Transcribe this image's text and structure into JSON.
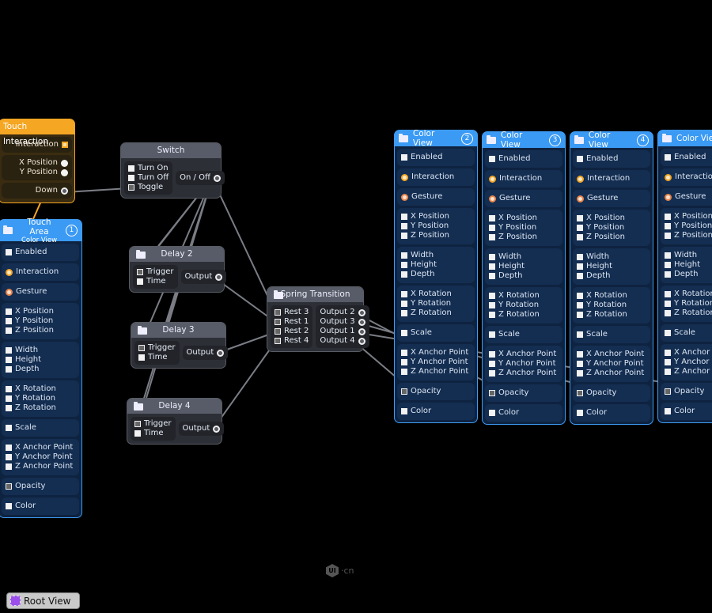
{
  "colors": {
    "layer_accent": "#3b9af4",
    "touch_accent": "#f5a623",
    "patch_header": "#585c68",
    "wire": "#7a7d85",
    "root_icon": "#9b4fe8"
  },
  "touch_interaction": {
    "title": "Touch Interaction",
    "ports": [
      "Interaction",
      "X Position",
      "Y Position",
      "Down"
    ]
  },
  "switch": {
    "title": "Switch",
    "inputs": [
      "Turn On",
      "Turn Off",
      "Toggle"
    ],
    "output": "On / Off"
  },
  "delays": [
    {
      "title": "Delay 2",
      "inputs": [
        "Trigger",
        "Time"
      ],
      "output": "Output"
    },
    {
      "title": "Delay 3",
      "inputs": [
        "Trigger",
        "Time"
      ],
      "output": "Output"
    },
    {
      "title": "Delay 4",
      "inputs": [
        "Trigger",
        "Time"
      ],
      "output": "Output"
    }
  ],
  "spring": {
    "title": "Spring Transition",
    "inputs": [
      "Rest 3",
      "Rest 1",
      "Rest 2",
      "Rest 4"
    ],
    "outputs": [
      "Output 2",
      "Output 3",
      "Output 1",
      "Output 4"
    ]
  },
  "layer_groups": [
    [
      "Enabled"
    ],
    [
      "Interaction"
    ],
    [
      "Gesture"
    ],
    [
      "X Position",
      "Y Position",
      "Z Position"
    ],
    [
      "Width",
      "Height",
      "Depth"
    ],
    [
      "X Rotation",
      "Y Rotation",
      "Z Rotation"
    ],
    [
      "Scale"
    ],
    [
      "X Anchor Point",
      "Y Anchor Point",
      "Z Anchor Point"
    ],
    [
      "Opacity"
    ],
    [
      "Color"
    ]
  ],
  "layers": [
    {
      "title": "Touch Area",
      "subtitle": "Color View",
      "badge": "1"
    },
    {
      "title": "Color View",
      "badge": "2"
    },
    {
      "title": "Color View",
      "badge": "3"
    },
    {
      "title": "Color View",
      "badge": "4"
    },
    {
      "title": "Color View",
      "badge": ""
    }
  ],
  "root_view": {
    "label": "Root View",
    "icon": "layer-square-icon"
  },
  "watermark": {
    "logo": "UI",
    "text": "·cn"
  }
}
